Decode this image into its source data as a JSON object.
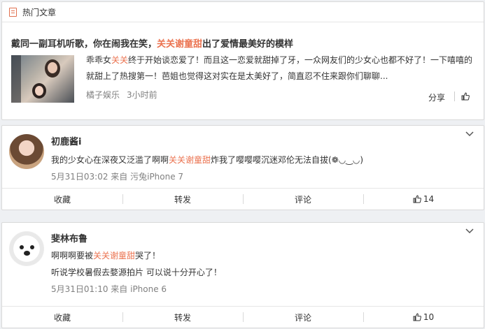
{
  "hot": {
    "header": "热门文章",
    "title_prefix": "戴同一副耳机听歌，你在闹我在笑，",
    "title_highlight": "关关谢童甜",
    "title_suffix": "出了爱情最美好的模样",
    "text_prefix": "乖乖女",
    "text_highlight": "关关",
    "text_suffix": "终于开始谈恋爱了！而且这一恋爱就甜掉了牙，一众网友们的少女心也都不好了！一下嘻嘻的就甜上了热搜第一！芭姐也觉得这对实在是太美好了，简直忍不住来跟你们聊聊...",
    "source": "橘子娱乐",
    "time": "3小时前",
    "share_label": "分享",
    "like_icon": "thumbs-up-icon"
  },
  "comments": [
    {
      "username": "初鹿酱i",
      "text_prefix": "我的少女心在深夜又泛滥了啊啊",
      "text_highlight": "关关谢童甜",
      "text_suffix": "炸我了嘤嘤嘤沉迷邓伦无法自拔(❁◡‿◡)",
      "meta": "5月31日03:02 来自 污兔iPhone 7",
      "actions": {
        "favorite": "收藏",
        "repost": "转发",
        "comment": "评论",
        "likes": "14"
      }
    },
    {
      "username": "斐林布鲁",
      "text_prefix": "啊啊啊要被",
      "text_highlight": "关关谢童甜",
      "text_suffix": "哭了！",
      "text_line2": "听说学校暑假去婺源拍片 可以说十分开心了！",
      "meta": "5月31日01:10 来自 iPhone 6",
      "actions": {
        "favorite": "收藏",
        "repost": "转发",
        "comment": "评论",
        "likes": "10"
      }
    }
  ],
  "colors": {
    "highlight": "#eb7350",
    "meta": "#808080",
    "text": "#333333"
  }
}
